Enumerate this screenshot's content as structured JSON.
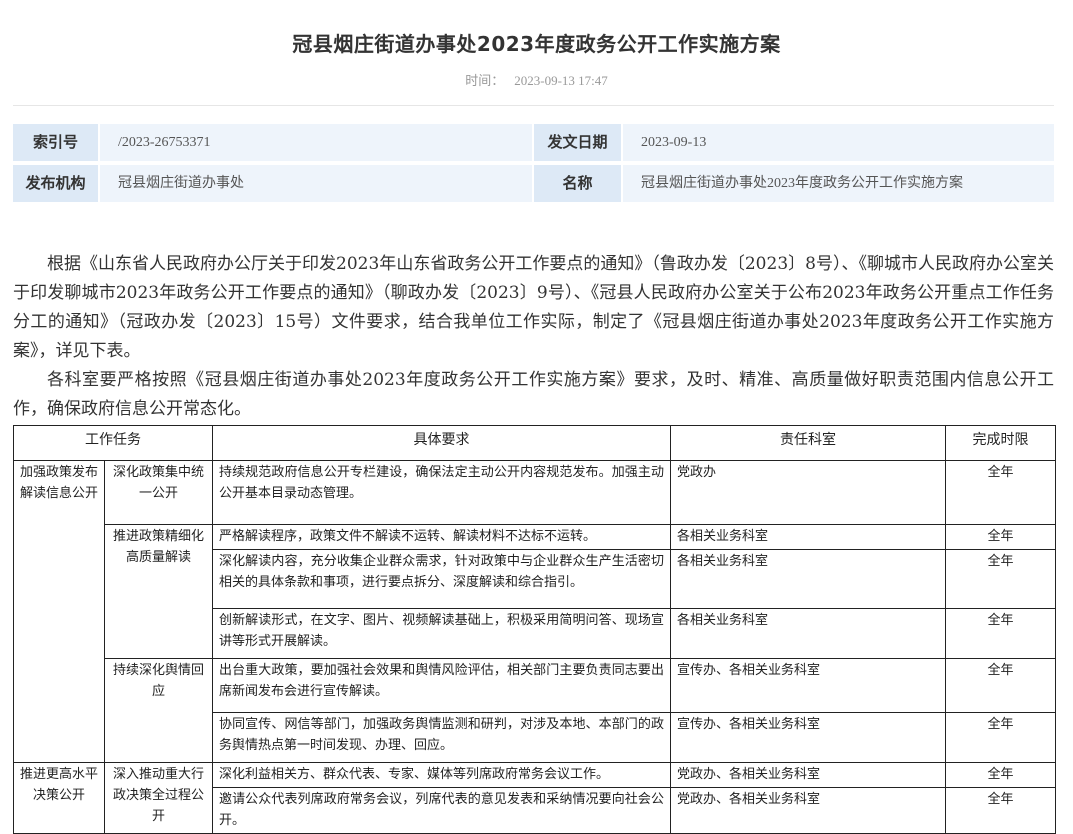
{
  "header": {
    "title": "冠县烟庄街道办事处2023年度政务公开工作实施方案",
    "time_label": "时间：",
    "time_value": "2023-09-13 17:47"
  },
  "meta": {
    "index_label": "索引号",
    "index_value": "/2023-26753371",
    "date_label": "发文日期",
    "date_value": "2023-09-13",
    "org_label": "发布机构",
    "org_value": "冠县烟庄街道办事处",
    "name_label": "名称",
    "name_value": "冠县烟庄街道办事处2023年度政务公开工作实施方案"
  },
  "body": {
    "para1": "根据《山东省人民政府办公厅关于印发2023年山东省政务公开工作要点的通知》（鲁政办发〔2023〕8号）、《聊城市人民政府办公室关于印发聊城市2023年政务公开工作要点的通知》（聊政办发〔2023〕9号）、《冠县人民政府办公室关于公布2023年政务公开重点工作任务分工的通知》（冠政办发〔2023〕15号）文件要求，结合我单位工作实际，制定了《冠县烟庄街道办事处2023年度政务公开工作实施方案》，详见下表。",
    "para2": "各科室要严格按照《冠县烟庄街道办事处2023年度政务公开工作实施方案》要求，及时、精准、高质量做好职责范围内信息公开工作，确保政府信息公开常态化。"
  },
  "table": {
    "headers": [
      "工作任务",
      "具体要求",
      "责任科室",
      "完成时限"
    ],
    "cat1": "加强政策发布解读信息公开",
    "cat2": "推进更高水平决策公开",
    "sub1": "深化政策集中统一公开",
    "sub2": "推进政策精细化高质量解读",
    "sub3": "持续深化舆情回应",
    "sub4": "深入推动重大行政决策全过程公开",
    "rows": [
      {
        "req": "持续规范政府信息公开专栏建设，确保法定主动公开内容规范发布。加强主动公开基本目录动态管理。",
        "dept": "党政办",
        "time": "全年"
      },
      {
        "req": "严格解读程序，政策文件不解读不运转、解读材料不达标不运转。",
        "dept": "各相关业务科室",
        "time": "全年"
      },
      {
        "req": "深化解读内容，充分收集企业群众需求，针对政策中与企业群众生产生活密切相关的具体条款和事项，进行要点拆分、深度解读和综合指引。",
        "dept": "各相关业务科室",
        "time": "全年"
      },
      {
        "req": "创新解读形式，在文字、图片、视频解读基础上，积极采用简明问答、现场宣讲等形式开展解读。",
        "dept": "各相关业务科室",
        "time": "全年"
      },
      {
        "req": "出台重大政策，要加强社会效果和舆情风险评估，相关部门主要负责同志要出席新闻发布会进行宣传解读。",
        "dept": "宣传办、各相关业务科室",
        "time": "全年"
      },
      {
        "req": "协同宣传、网信等部门，加强政务舆情监测和研判，对涉及本地、本部门的政务舆情热点第一时间发现、办理、回应。",
        "dept": "宣传办、各相关业务科室",
        "time": "全年"
      },
      {
        "req": "深化利益相关方、群众代表、专家、媒体等列席政府常务会议工作。",
        "dept": "党政办、各相关业务科室",
        "time": "全年"
      },
      {
        "req": "邀请公众代表列席政府常务会议，列席代表的意见发表和采纳情况要向社会公开。",
        "dept": "党政办、各相关业务科室",
        "time": "全年"
      }
    ]
  }
}
